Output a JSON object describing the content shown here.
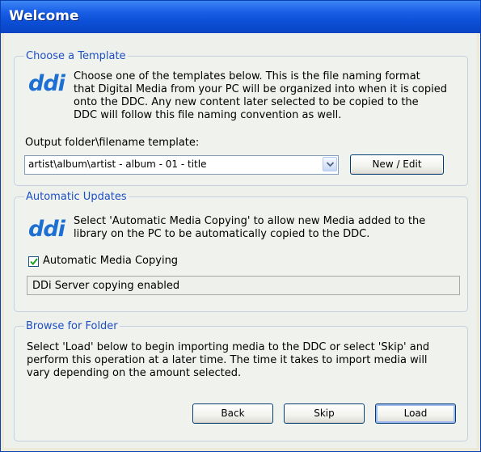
{
  "window": {
    "title": "Welcome",
    "titlebar_color": "#0b4fd6"
  },
  "template_section": {
    "legend": "Choose a Template",
    "logo_text": "ddi",
    "description_lines": [
      "Choose one of the templates below.  This is the file naming format",
      "that Digital Media from your PC will be organized into when it is copied",
      "onto the DDC.  Any new content later selected to be copied to the",
      "DDC will follow this file naming convention as well."
    ],
    "output_label": "Output folder\\filename template:",
    "template_value": "artist\\album\\artist - album - 01 - title",
    "new_edit_label": "New / Edit"
  },
  "updates_section": {
    "legend": "Automatic Updates",
    "logo_text": "ddi",
    "description_lines": [
      "Select 'Automatic Media Copying' to allow new Media added to the",
      "library on the PC to be automatically copied to the DDC."
    ],
    "checkbox_label": "Automatic Media Copying",
    "checkbox_checked": true,
    "status_text": "DDi Server copying enabled"
  },
  "browse_section": {
    "legend": "Browse for Folder",
    "description_lines": [
      "Select 'Load' below to begin importing media to the DDC or select 'Skip' and",
      "perform this operation at a later time. The time it takes to import media will",
      "vary depending on the amount selected."
    ]
  },
  "buttons": {
    "back": "Back",
    "skip": "Skip",
    "load": "Load"
  },
  "colors": {
    "legend_blue": "#1d4fc4",
    "logo_blue": "#1d6fd4",
    "logo_accent": "#e8a21a"
  }
}
